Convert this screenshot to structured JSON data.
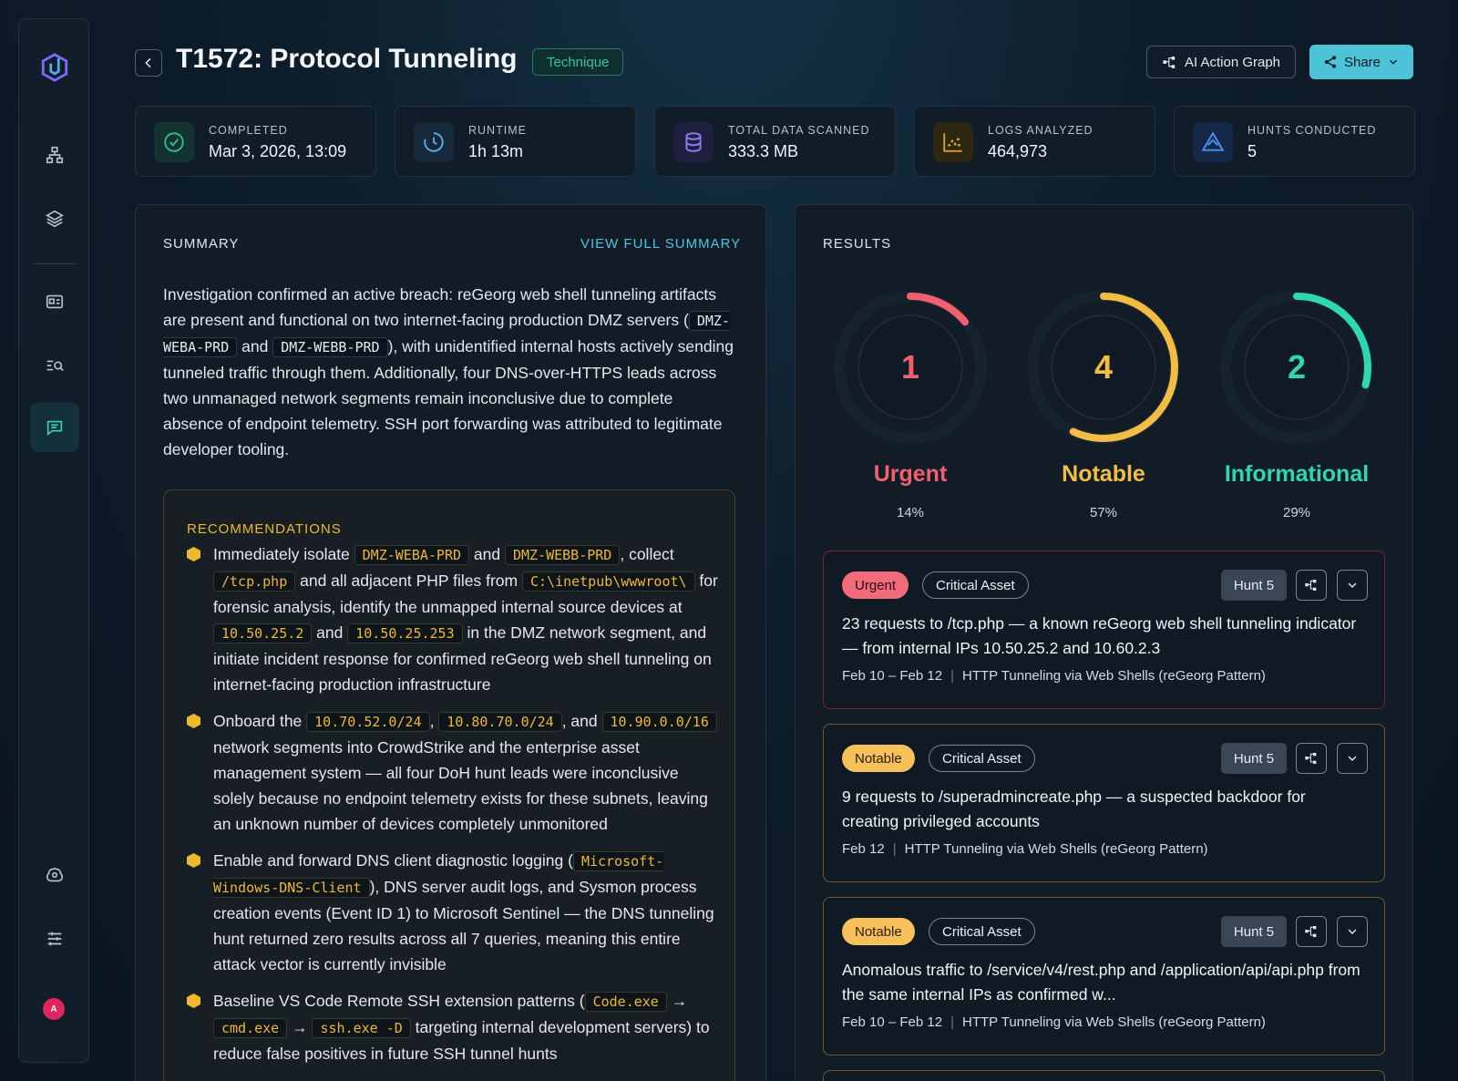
{
  "header": {
    "title": "T1572: Protocol Tunneling",
    "badge": "Technique",
    "graph_button": "AI Action Graph",
    "share_button": "Share"
  },
  "sidebar": {
    "items": [
      {
        "icon": "org-chart-icon"
      },
      {
        "icon": "layers-icon"
      },
      {
        "icon": "id-card-icon"
      },
      {
        "icon": "list-search-icon"
      },
      {
        "icon": "chat-icon",
        "active": true
      },
      {
        "icon": "brain-settings-icon"
      },
      {
        "icon": "sliders-icon"
      }
    ],
    "avatar": "A"
  },
  "stats": [
    {
      "label": "COMPLETED",
      "value": "Mar 3, 2026, 13:09",
      "icon": "check-circle-icon",
      "color": "#2fb98a"
    },
    {
      "label": "RUNTIME",
      "value": "1h 13m",
      "icon": "clock-icon",
      "color": "#5aa8e6"
    },
    {
      "label": "TOTAL DATA SCANNED",
      "value": "333.3 MB",
      "icon": "database-icon",
      "color": "#8b7cf0"
    },
    {
      "label": "LOGS ANALYZED",
      "value": "464,973",
      "icon": "logs-chart-icon",
      "color": "#e0a82a"
    },
    {
      "label": "HUNTS CONDUCTED",
      "value": "5",
      "icon": "hunt-icon",
      "color": "#4c8ef0"
    }
  ],
  "summary": {
    "title": "SUMMARY",
    "view_full": "VIEW FULL SUMMARY",
    "p1": "Investigation confirmed an active breach: reGeorg web shell tunneling artifacts are present and functional on two internet-facing production DMZ servers (",
    "host1": "DMZ-WEBA-PRD",
    "and1": " and ",
    "host2": "DMZ-WEBB-PRD",
    "p2": "), with unidentified internal hosts actively sending tunneled traffic through them. Additionally, four DNS-over-HTTPS leads across two unmanaged network segments remain inconclusive due to complete absence of endpoint telemetry. SSH port forwarding was attributed to legitimate developer tooling.",
    "rec_title": "RECOMMENDATIONS",
    "rec1": {
      "a": "Immediately isolate ",
      "c1": "DMZ-WEBA-PRD",
      "b": " and ",
      "c2": "DMZ-WEBB-PRD",
      "c": ", collect ",
      "c3": "/tcp.php",
      "d": " and all adjacent PHP files from ",
      "c4": "C:\\inetpub\\wwwroot\\",
      "e": " for forensic analysis, identify the unmapped internal source devices at ",
      "c5": "10.50.25.2",
      "f": " and ",
      "c6": "10.50.25.253",
      "g": " in the DMZ network segment, and initiate incident response for confirmed reGeorg web shell tunneling on internet-facing production infrastructure"
    },
    "rec2": {
      "a": "Onboard the ",
      "c1": "10.70.52.0/24",
      "b": ", ",
      "c2": "10.80.70.0/24",
      "c": ", and ",
      "c3": "10.90.0.0/16",
      "d": " network segments into CrowdStrike and the enterprise asset management system — all four DoH hunt leads were inconclusive solely because no endpoint telemetry exists for these subnets, leaving an unknown number of devices completely unmonitored"
    },
    "rec3": {
      "a": "Enable and forward DNS client diagnostic logging (",
      "c1": "Microsoft-Windows-DNS-Client",
      "b": "), DNS server audit logs, and Sysmon process creation events (Event ID 1) to Microsoft Sentinel — the DNS tunneling hunt returned zero results across all 7 queries, meaning this entire attack vector is currently invisible"
    },
    "rec4": {
      "a": "Baseline VS Code Remote SSH extension patterns (",
      "c1": "Code.exe",
      "b": " → ",
      "c2": "cmd.exe",
      "c": " → ",
      "c3": "ssh.exe -D",
      "d": " targeting internal development servers) to reduce false positives in future SSH tunnel hunts"
    }
  },
  "results": {
    "title": "RESULTS",
    "gauges": [
      {
        "count": "1",
        "label": "Urgent",
        "pct": "14%",
        "fraction": 0.14,
        "color": "#f2606f"
      },
      {
        "count": "4",
        "label": "Notable",
        "pct": "57%",
        "fraction": 0.57,
        "color": "#f3bd43"
      },
      {
        "count": "2",
        "label": "Informational",
        "pct": "29%",
        "fraction": 0.29,
        "color": "#2fd6b0"
      }
    ],
    "cards": [
      {
        "severity": "Urgent",
        "asset": "Critical Asset",
        "hunt": "Hunt 5",
        "title": "23 requests to /tcp.php — a known reGeorg web shell tunneling indicator — from internal IPs 10.50.25.2 and 10.60.2.3",
        "date": "Feb 10 – Feb 12",
        "category": "HTTP Tunneling via Web Shells (reGeorg Pattern)"
      },
      {
        "severity": "Notable",
        "asset": "Critical Asset",
        "hunt": "Hunt 5",
        "title": "9 requests to /superadmincreate.php — a suspected backdoor for creating privileged accounts",
        "date": "Feb 12",
        "category": "HTTP Tunneling via Web Shells (reGeorg Pattern)"
      },
      {
        "severity": "Notable",
        "asset": "Critical Asset",
        "hunt": "Hunt 5",
        "title": "Anomalous traffic to /service/v4/rest.php and /application/api/api.php from the same internal IPs as confirmed w...",
        "date": "Feb 10 – Feb 12",
        "category": "HTTP Tunneling via Web Shells (reGeorg Pattern)"
      }
    ]
  }
}
